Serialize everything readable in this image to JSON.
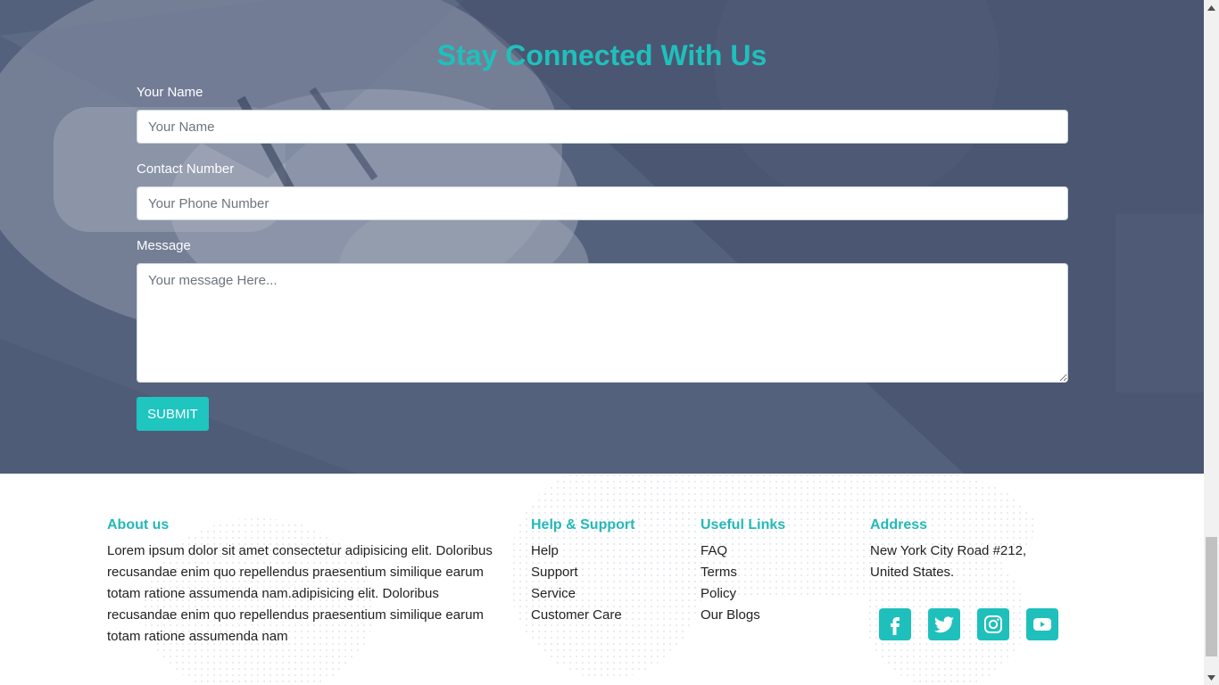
{
  "contact": {
    "title": "Stay Connected With Us",
    "name_label": "Your Name",
    "name_placeholder": "Your Name",
    "phone_label": "Contact Number",
    "phone_placeholder": "Your Phone Number",
    "message_label": "Message",
    "message_placeholder": "Your message Here...",
    "submit_label": "SUBMIT"
  },
  "footer": {
    "about": {
      "heading": "About us",
      "text": "Lorem ipsum dolor sit amet consectetur adipisicing elit. Doloribus recusandae enim quo repellendus praesentium similique earum totam ratione assumenda nam.adipisicing elit. Doloribus recusandae enim quo repellendus praesentium similique earum totam ratione assumenda nam"
    },
    "help": {
      "heading": "Help & Support",
      "links": [
        "Help",
        "Support",
        "Service",
        "Customer Care"
      ]
    },
    "useful": {
      "heading": "Useful Links",
      "links": [
        "FAQ",
        "Terms",
        "Policy",
        "Our Blogs"
      ]
    },
    "address": {
      "heading": "Address",
      "line1": "New York City Road #212,",
      "line2": "United States."
    },
    "social": [
      "facebook-icon",
      "twitter-icon",
      "instagram-icon",
      "youtube-icon"
    ]
  },
  "colors": {
    "accent": "#1fc0bb",
    "section_bg": "#5d6a85",
    "heading": "#23b9b6"
  }
}
